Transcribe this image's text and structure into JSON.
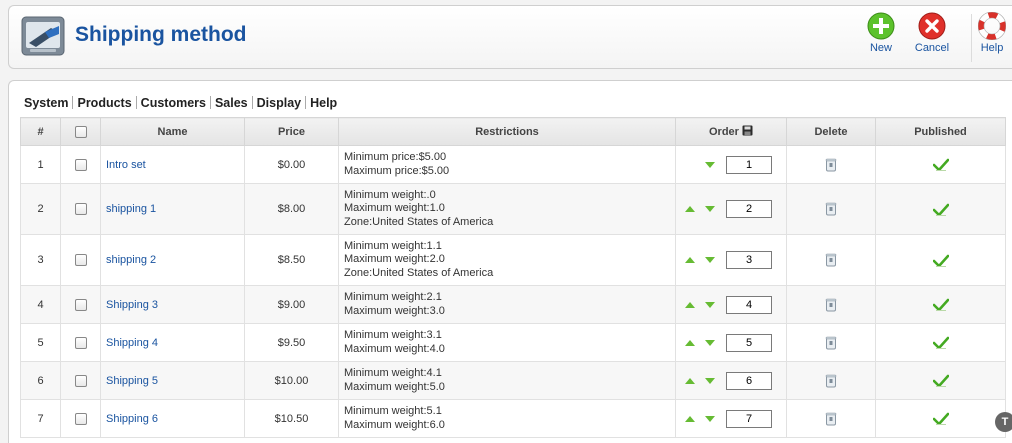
{
  "header": {
    "title": "Shipping method",
    "toolbar": [
      {
        "id": "new",
        "label": "New",
        "icon": "add-icon"
      },
      {
        "id": "cancel",
        "label": "Cancel",
        "icon": "cancel-icon"
      },
      {
        "id": "help",
        "label": "Help",
        "icon": "lifebuoy-icon"
      }
    ]
  },
  "menu": {
    "items": [
      "System",
      "Products",
      "Customers",
      "Sales",
      "Display",
      "Help"
    ]
  },
  "table": {
    "columns": [
      "#",
      "",
      "Name",
      "Price",
      "Restrictions",
      "Order",
      "Delete",
      "Published"
    ],
    "rows": [
      {
        "num": "1",
        "name": "Intro set",
        "price": "$0.00",
        "restrictions": [
          "Minimum price:$5.00",
          "Maximum price:$5.00"
        ],
        "order": "1",
        "up": false,
        "down": true
      },
      {
        "num": "2",
        "name": "shipping 1",
        "price": "$8.00",
        "restrictions": [
          "Minimum weight:.0",
          "Maximum weight:1.0",
          "Zone:United States of America"
        ],
        "order": "2",
        "up": true,
        "down": true
      },
      {
        "num": "3",
        "name": "shipping 2",
        "price": "$8.50",
        "restrictions": [
          "Minimum weight:1.1",
          "Maximum weight:2.0",
          "Zone:United States of America"
        ],
        "order": "3",
        "up": true,
        "down": true
      },
      {
        "num": "4",
        "name": "Shipping 3",
        "price": "$9.00",
        "restrictions": [
          "Minimum weight:2.1",
          "Maximum weight:3.0"
        ],
        "order": "4",
        "up": true,
        "down": true
      },
      {
        "num": "5",
        "name": "Shipping 4",
        "price": "$9.50",
        "restrictions": [
          "Minimum weight:3.1",
          "Maximum weight:4.0"
        ],
        "order": "5",
        "up": true,
        "down": true
      },
      {
        "num": "6",
        "name": "Shipping 5",
        "price": "$10.00",
        "restrictions": [
          "Minimum weight:4.1",
          "Maximum weight:5.0"
        ],
        "order": "6",
        "up": true,
        "down": true
      },
      {
        "num": "7",
        "name": "Shipping 6",
        "price": "$10.50",
        "restrictions": [
          "Minimum weight:5.1",
          "Maximum weight:6.0"
        ],
        "order": "7",
        "up": true,
        "down": true
      }
    ]
  },
  "corner_button": "T",
  "colors": {
    "title": "#1a54a0",
    "link": "#1a54a0",
    "arrow": "#66bb33",
    "check": "#44aa22"
  }
}
